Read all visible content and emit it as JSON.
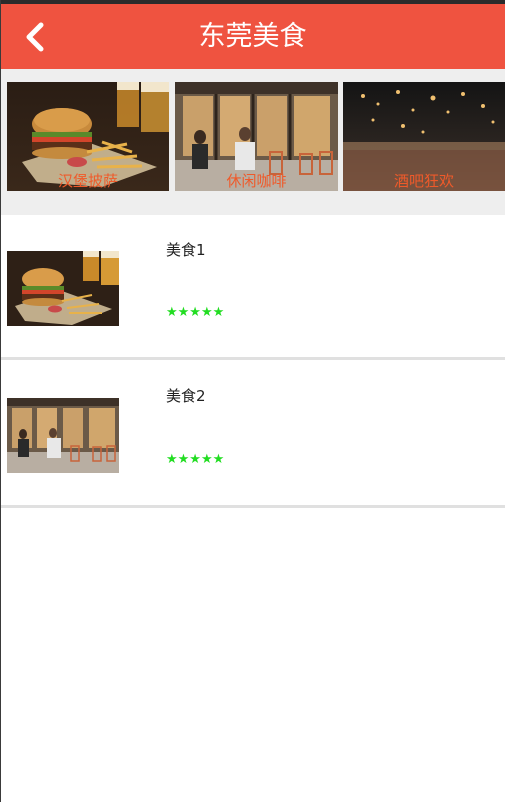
{
  "header": {
    "title": "东莞美食",
    "back_icon": "back-chevron-icon"
  },
  "banners": [
    {
      "caption": "汉堡披萨",
      "image": "burger-and-fries-photo"
    },
    {
      "caption": "休闲咖啡",
      "image": "cafe-terrace-photo"
    },
    {
      "caption": "酒吧狂欢",
      "image": "bar-night-photo"
    }
  ],
  "list": [
    {
      "name": "美食1",
      "stars": "★★★★★",
      "image": "burger-and-fries-photo"
    },
    {
      "name": "美食2",
      "stars": "★★★★★",
      "image": "cafe-terrace-photo"
    }
  ],
  "colors": {
    "header_bg": "#ef5340",
    "caption": "#ef5a2a",
    "stars": "#22dd22"
  }
}
